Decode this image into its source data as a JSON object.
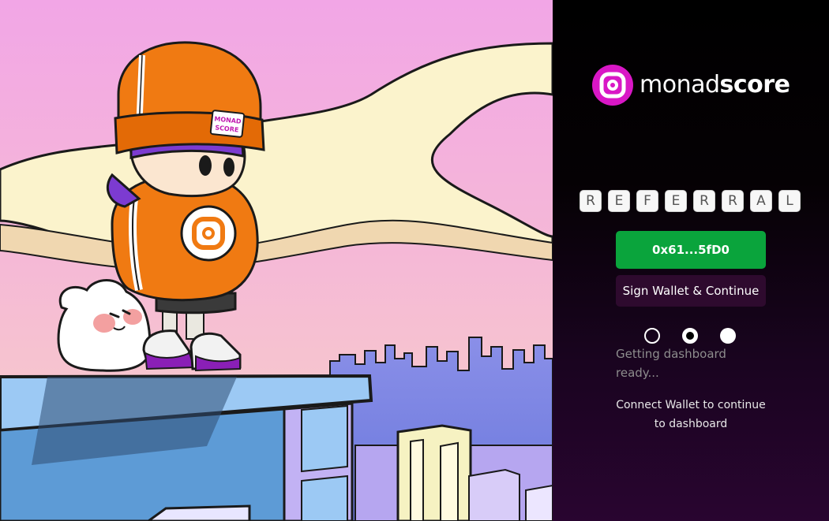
{
  "brand": {
    "name_light": "monad",
    "name_bold": "score",
    "logo_icon": "monadscore-logo-icon",
    "accent": "#d917c6"
  },
  "referral": {
    "characters": [
      "R",
      "E",
      "F",
      "E",
      "R",
      "R",
      "A",
      "L"
    ]
  },
  "wallet": {
    "address_label": "0x61...5fD0",
    "color": "#0aa43c"
  },
  "sign_button": {
    "label": "Sign Wallet & Continue"
  },
  "progress": {
    "steps": 3,
    "current": 2
  },
  "status_text": "Getting dashboard ready...",
  "note_text": "Connect Wallet to continue to dashboard",
  "illustration": {
    "hat_label": "monad score",
    "hoodie_label": "monadscore",
    "icon": "monad-mascot-illustration"
  }
}
